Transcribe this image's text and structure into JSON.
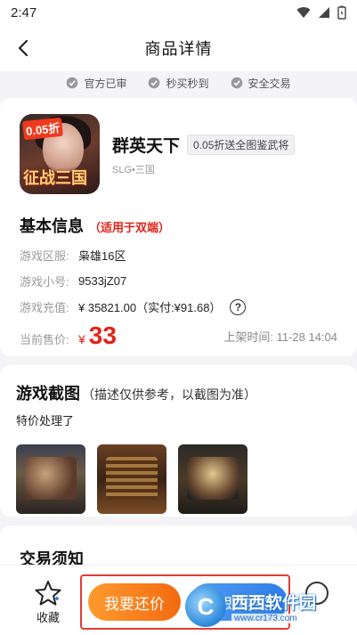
{
  "status_bar": {
    "time": "2:47"
  },
  "nav": {
    "title": "商品详情"
  },
  "trust": [
    "官方已审",
    "秒买秒到",
    "安全交易"
  ],
  "game": {
    "name": "群英天下",
    "discount_badge": "0.05折送全图鉴武将",
    "tags": "SLG•三国",
    "icon_tag": "0.05折",
    "icon_text": "征战三国"
  },
  "basic_info": {
    "title": "基本信息",
    "note": "（适用于双端）",
    "rows": [
      {
        "label": "游戏区服:",
        "value": "枭雄16区"
      },
      {
        "label": "游戏小号:",
        "value": "9533jZ07"
      },
      {
        "label": "游戏充值:",
        "value": "¥  35821.00（实付:¥91.68）"
      }
    ],
    "price_label": "当前售价:",
    "currency": "¥",
    "price": "33",
    "list_time_label": "上架时间:",
    "list_time": "11-28 14:04"
  },
  "screenshots": {
    "title": "游戏截图",
    "note": "（描述仅供参考，以截图为准）",
    "desc": "特价处理了"
  },
  "notice": {
    "title": "交易须知"
  },
  "bottom": {
    "fav_label": "收藏",
    "bargain_label": "我要还价",
    "buy_label": "立即购买"
  },
  "watermark": {
    "cn": "西西软件园",
    "url": "www.cr173.com"
  },
  "colors": {
    "price_red": "#e2231a",
    "bargain_orange": "#f26a10",
    "buy_blue": "#2f7ee8"
  }
}
